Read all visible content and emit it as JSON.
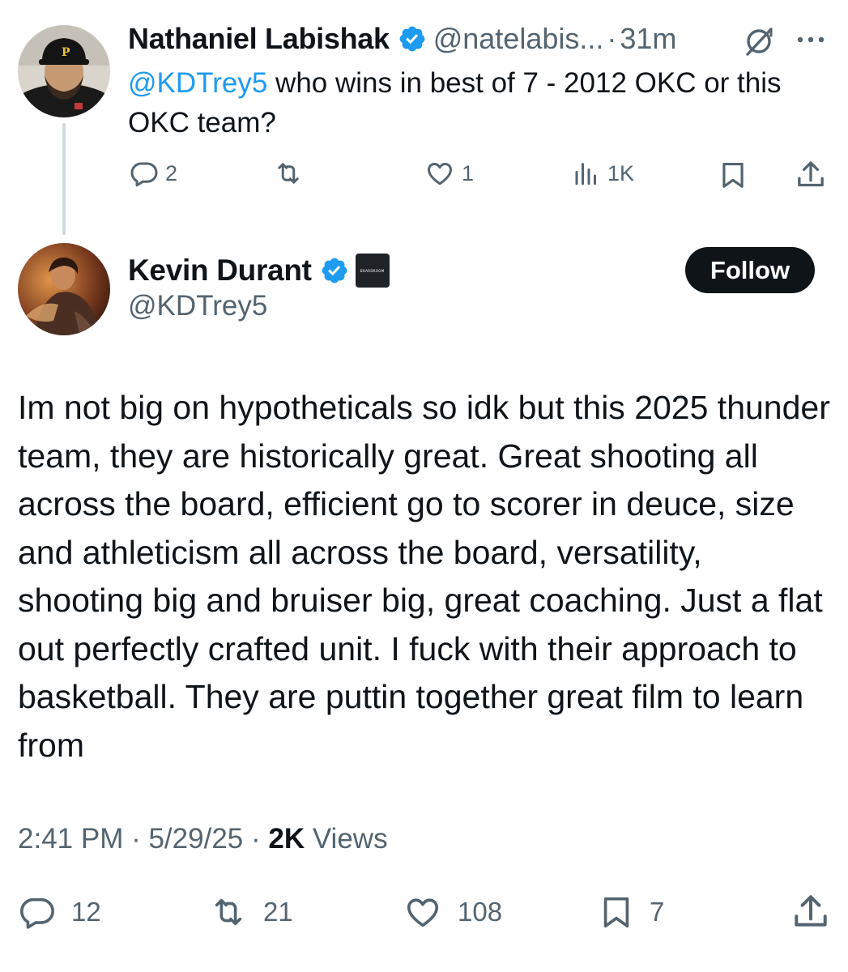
{
  "parent_tweet": {
    "name": "Nathaniel Labishak",
    "handle": "@natelabis...",
    "separator": "·",
    "time": "31m",
    "mention": "@KDTrey5",
    "text": " who wins in best of 7 - 2012 OKC or this OKC team?",
    "actions": {
      "replies": "2",
      "reposts": "",
      "likes": "1",
      "views": "1K"
    }
  },
  "main_tweet": {
    "name": "Kevin Durant",
    "handle": "@KDTrey5",
    "affiliation_badge": "BOARDROOM",
    "follow_label": "Follow",
    "text": "Im not big on hypotheticals so idk but this 2025 thunder team, they are historically great. Great shooting all across the board, efficient go to scorer in deuce, size and athleticism all across the board, versatility, shooting big and bruiser big, great coaching. Just a flat out perfectly crafted unit. I fuck with their approach to basketball. They are puttin together great film to learn from",
    "time": "2:41 PM",
    "sep1": " · ",
    "date": "5/29/25",
    "sep2": " · ",
    "views_count": "2K",
    "views_label": " Views",
    "actions": {
      "replies": "12",
      "reposts": "21",
      "likes": "108",
      "bookmarks": "7"
    }
  },
  "colors": {
    "text_primary": "#0f1419",
    "text_secondary": "#536471",
    "link": "#1d9bf0",
    "verified": "#1d9bf0",
    "thread_line": "#cfd9de",
    "follow_bg": "#0f1419"
  },
  "icons": [
    "verified-badge-icon",
    "grok-icon",
    "more-icon",
    "reply-icon",
    "repost-icon",
    "like-icon",
    "views-icon",
    "bookmark-icon",
    "share-icon"
  ]
}
